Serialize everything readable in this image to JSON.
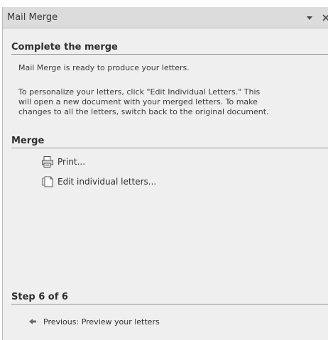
{
  "pane": {
    "title": "Mail Merge"
  },
  "complete_section": {
    "heading": "Complete the merge",
    "ready_text": "Mail Merge is ready to produce your letters.",
    "personalize_lines": [
      "To personalize your letters, click \"Edit Individual Letters.\" This",
      "will open a new document with your merged letters. To make",
      "changes to all the letters, switch back to the original document."
    ]
  },
  "merge_section": {
    "heading": "Merge",
    "actions": [
      {
        "label": "Print...",
        "icon": "print-icon"
      },
      {
        "label": "Edit individual letters...",
        "icon": "edit-letters-icon"
      }
    ]
  },
  "step_section": {
    "heading": "Step 6 of 6",
    "previous_link": "Previous: Preview your letters"
  }
}
